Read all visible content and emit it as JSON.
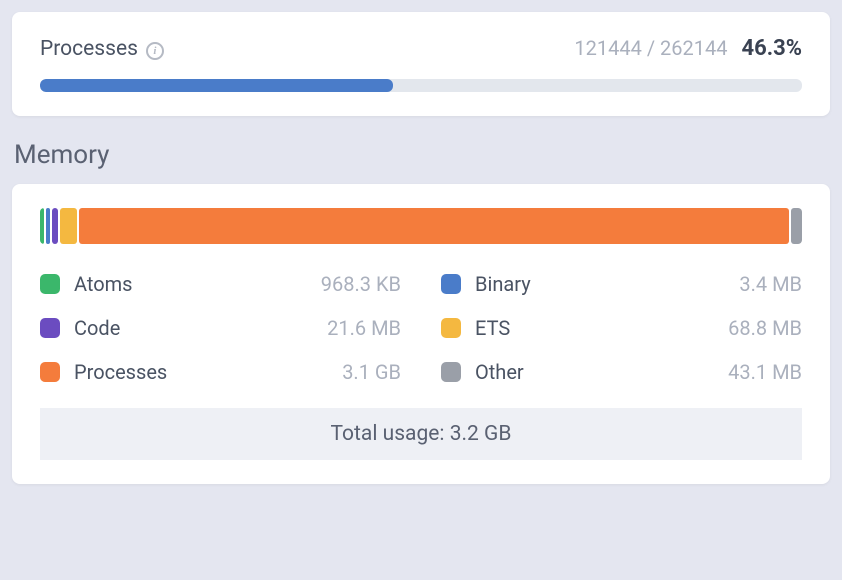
{
  "processes": {
    "title": "Processes",
    "count": "121444 / 262144",
    "percent": "46.3%",
    "fill_percent": 46.3
  },
  "memory": {
    "title": "Memory",
    "segments": [
      {
        "name": "Atoms",
        "value": "968.3 KB",
        "color": "#3bb76b",
        "width": 0.5
      },
      {
        "name": "Binary",
        "value": "3.4 MB",
        "color": "#4a7cc9",
        "width": 0.5
      },
      {
        "name": "Code",
        "value": "21.6 MB",
        "color": "#6b4cc0",
        "width": 0.8
      },
      {
        "name": "ETS",
        "value": "68.8 MB",
        "color": "#f4b840",
        "width": 2.3
      },
      {
        "name": "Processes",
        "value": "3.1 GB",
        "color": "#f47c3c",
        "width": 94.2
      },
      {
        "name": "Other",
        "value": "43.1 MB",
        "color": "#9a9fa8",
        "width": 1.5
      }
    ],
    "legend": [
      {
        "name": "Atoms",
        "value": "968.3 KB",
        "color": "#3bb76b"
      },
      {
        "name": "Binary",
        "value": "3.4 MB",
        "color": "#4a7cc9"
      },
      {
        "name": "Code",
        "value": "21.6 MB",
        "color": "#6b4cc0"
      },
      {
        "name": "ETS",
        "value": "68.8 MB",
        "color": "#f4b840"
      },
      {
        "name": "Processes",
        "value": "3.1 GB",
        "color": "#f47c3c"
      },
      {
        "name": "Other",
        "value": "43.1 MB",
        "color": "#9a9fa8"
      }
    ],
    "total": "Total usage: 3.2 GB"
  }
}
